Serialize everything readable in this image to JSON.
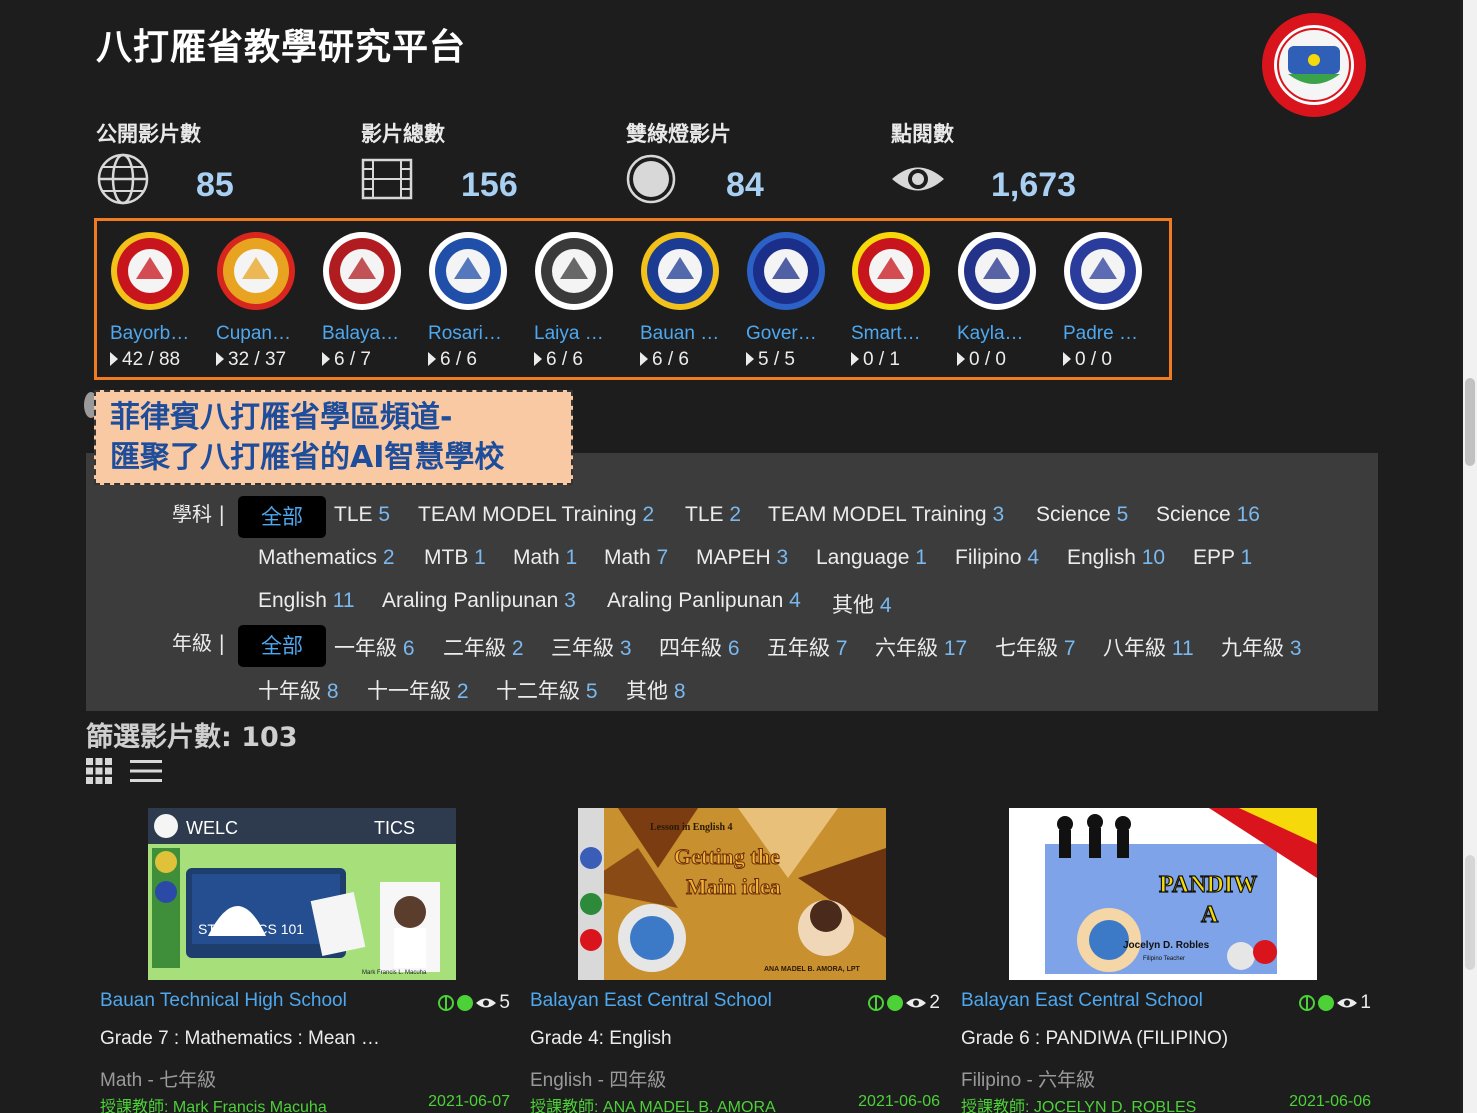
{
  "header": {
    "title": "八打雁省教學研究平台"
  },
  "stats": [
    {
      "label": "公開影片數",
      "value": "85",
      "icon": "globe-icon"
    },
    {
      "label": "影片總數",
      "value": "156",
      "icon": "film-icon"
    },
    {
      "label": "雙綠燈影片",
      "value": "84",
      "icon": "circle-light-icon"
    },
    {
      "label": "點閱數",
      "value": "1,673",
      "icon": "eye-icon"
    }
  ],
  "schools": [
    {
      "name": "Bayorb…",
      "count": "42 / 88",
      "color": "#c8141c",
      "ring": "#f2c21a"
    },
    {
      "name": "Cupan…",
      "count": "32 / 37",
      "color": "#e8a420",
      "ring": "#d7261e"
    },
    {
      "name": "Balaya…",
      "count": "6 / 7",
      "color": "#b01c20",
      "ring": "#ffffff"
    },
    {
      "name": "Rosari…",
      "count": "6 / 6",
      "color": "#1f4fa8",
      "ring": "#ffffff"
    },
    {
      "name": "Laiya …",
      "count": "6 / 6",
      "color": "#3a3a3a",
      "ring": "#ffffff"
    },
    {
      "name": "Bauan …",
      "count": "6 / 6",
      "color": "#1c3c94",
      "ring": "#f2c21a"
    },
    {
      "name": "Gover…",
      "count": "5 / 5",
      "color": "#1b2f8a",
      "ring": "#2c62c8"
    },
    {
      "name": "Smart…",
      "count": "0 / 1",
      "color": "#c8141c",
      "ring": "#f5d90a"
    },
    {
      "name": "Kayla…",
      "count": "0 / 0",
      "color": "#23338a",
      "ring": "#ffffff"
    },
    {
      "name": "Padre …",
      "count": "0 / 0",
      "color": "#2b3d9c",
      "ring": "#ffffff"
    }
  ],
  "callout": {
    "line1": "菲律賓八打雁省學區頻道-",
    "line2": "匯聚了八打雁省的AI智慧學校"
  },
  "filters": {
    "subject_label": "學科 |",
    "grade_label": "年級 |",
    "all_label": "全部",
    "subjects": [
      {
        "name": "TLE",
        "count": "5"
      },
      {
        "name": "TEAM MODEL Training",
        "count": "2"
      },
      {
        "name": "TLE",
        "count": "2"
      },
      {
        "name": "TEAM MODEL Training",
        "count": "3"
      },
      {
        "name": "Science",
        "count": "5"
      },
      {
        "name": "Science",
        "count": "16"
      },
      {
        "name": "Mathematics",
        "count": "2"
      },
      {
        "name": "MTB",
        "count": "1"
      },
      {
        "name": "Math",
        "count": "1"
      },
      {
        "name": "Math",
        "count": "7"
      },
      {
        "name": "MAPEH",
        "count": "3"
      },
      {
        "name": "Language",
        "count": "1"
      },
      {
        "name": "Filipino",
        "count": "4"
      },
      {
        "name": "English",
        "count": "10"
      },
      {
        "name": "EPP",
        "count": "1"
      },
      {
        "name": "English",
        "count": "11"
      },
      {
        "name": "Araling Panlipunan",
        "count": "3"
      },
      {
        "name": "Araling Panlipunan",
        "count": "4"
      },
      {
        "name": "其他",
        "count": "4"
      }
    ],
    "grades": [
      {
        "name": "一年級",
        "count": "6"
      },
      {
        "name": "二年級",
        "count": "2"
      },
      {
        "name": "三年級",
        "count": "3"
      },
      {
        "name": "四年級",
        "count": "6"
      },
      {
        "name": "五年級",
        "count": "7"
      },
      {
        "name": "六年級",
        "count": "17"
      },
      {
        "name": "七年級",
        "count": "7"
      },
      {
        "name": "八年級",
        "count": "11"
      },
      {
        "name": "九年級",
        "count": "3"
      },
      {
        "name": "十年級",
        "count": "8"
      },
      {
        "name": "十一年級",
        "count": "2"
      },
      {
        "name": "十二年級",
        "count": "5"
      },
      {
        "name": "其他",
        "count": "8"
      }
    ]
  },
  "results": {
    "label": "篩選影片數: 103"
  },
  "videos": [
    {
      "school": "Bauan Technical High School",
      "views": "5",
      "title": "Grade 7 : Mathematics : Mean …",
      "subject": "Math - 七年級",
      "teacher": "授課教師: Mark Francis Macuha",
      "date": "2021-06-07",
      "thumb_text1": "WELC",
      "thumb_text2": "TICS",
      "thumb_text3": "STATISTICS 101",
      "thumb_caption": "Mark Francis L. Macuha"
    },
    {
      "school": "Balayan East Central School",
      "views": "2",
      "title": "Grade 4: English",
      "subject": "English - 四年級",
      "teacher": "授課教師: ANA MADEL B. AMORA",
      "date": "2021-06-06",
      "thumb_text1": "Lesson in English 4",
      "thumb_text2": "Getting the",
      "thumb_text3": "Main idea",
      "thumb_caption": "ANA MADEL B. AMORA, LPT"
    },
    {
      "school": "Balayan East Central School",
      "views": "1",
      "title": "Grade 6 : PANDIWA (FILIPINO)",
      "subject": "Filipino - 六年級",
      "teacher": "授課教師: JOCELYN D. ROBLES",
      "date": "2021-06-06",
      "thumb_text1": "PANDIW",
      "thumb_text2": "A",
      "thumb_text3": "Jocelyn D. Robles",
      "thumb_caption": "Filipino Teacher"
    }
  ]
}
